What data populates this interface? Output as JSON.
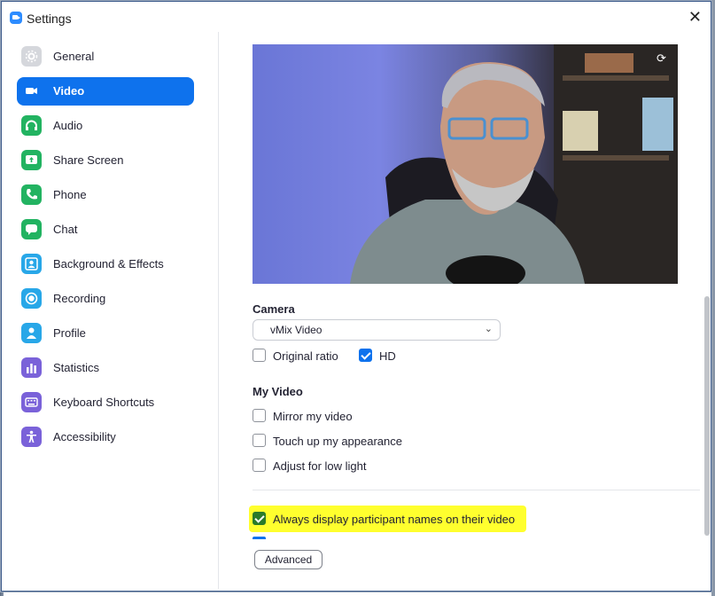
{
  "window": {
    "title": "Settings",
    "close_glyph": "✕"
  },
  "sidebar": {
    "items": [
      {
        "label": "General",
        "icon": "gear-icon",
        "color": "#d5d7dc",
        "active": false
      },
      {
        "label": "Video",
        "icon": "video-camera-icon",
        "color": "#0e72ed",
        "active": true
      },
      {
        "label": "Audio",
        "icon": "headphones-icon",
        "color": "#22b361",
        "active": false
      },
      {
        "label": "Share Screen",
        "icon": "share-screen-icon",
        "color": "#22b361",
        "active": false
      },
      {
        "label": "Phone",
        "icon": "phone-icon",
        "color": "#22b361",
        "active": false
      },
      {
        "label": "Chat",
        "icon": "chat-bubble-icon",
        "color": "#22b361",
        "active": false
      },
      {
        "label": "Background & Effects",
        "icon": "person-background-icon",
        "color": "#28a7e8",
        "active": false
      },
      {
        "label": "Recording",
        "icon": "record-icon",
        "color": "#28a7e8",
        "active": false
      },
      {
        "label": "Profile",
        "icon": "person-icon",
        "color": "#28a7e8",
        "active": false
      },
      {
        "label": "Statistics",
        "icon": "bar-chart-icon",
        "color": "#7a62d9",
        "active": false
      },
      {
        "label": "Keyboard Shortcuts",
        "icon": "keyboard-icon",
        "color": "#7a62d9",
        "active": false
      },
      {
        "label": "Accessibility",
        "icon": "accessibility-icon",
        "color": "#7a62d9",
        "active": false
      }
    ]
  },
  "video": {
    "camera_title": "Camera",
    "camera_select": "vMix Video",
    "original_ratio_label": "Original ratio",
    "original_ratio_checked": false,
    "hd_label": "HD",
    "hd_checked": true,
    "my_video_title": "My Video",
    "mirror_label": "Mirror my video",
    "mirror_checked": false,
    "touchup_label": "Touch up my appearance",
    "touchup_checked": false,
    "lowlight_label": "Adjust for low light",
    "lowlight_checked": false,
    "always_display_label": "Always display participant names on their video",
    "always_display_checked": true,
    "advanced_button": "Advanced",
    "highlight_color": "#ffff2e"
  }
}
